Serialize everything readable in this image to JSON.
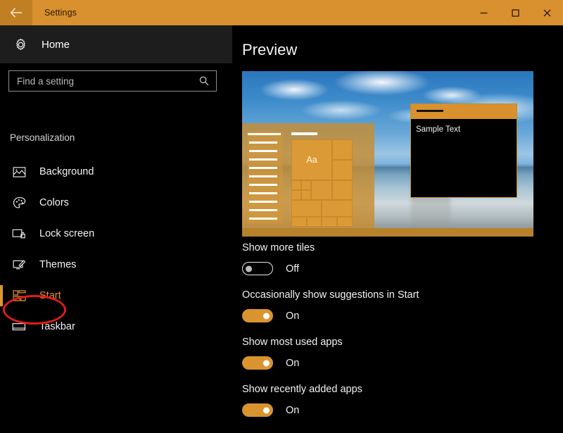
{
  "titlebar": {
    "back_label": "back-arrow",
    "title": "Settings",
    "minimize_label": "Minimize",
    "maximize_label": "Maximize",
    "close_label": "Close",
    "bg_color": "#d8912e"
  },
  "sidebar": {
    "home_label": "Home",
    "search": {
      "placeholder": "Find a setting",
      "value": ""
    },
    "section_header": "Personalization",
    "items": [
      {
        "label": "Background",
        "icon": "picture-icon",
        "selected": false
      },
      {
        "label": "Colors",
        "icon": "palette-icon",
        "selected": false
      },
      {
        "label": "Lock screen",
        "icon": "lock-screen-icon",
        "selected": false
      },
      {
        "label": "Themes",
        "icon": "themes-icon",
        "selected": false
      },
      {
        "label": "Start",
        "icon": "start-tiles-icon",
        "selected": true
      },
      {
        "label": "Taskbar",
        "icon": "taskbar-icon",
        "selected": false
      }
    ],
    "annotation": {
      "type": "red-ellipse",
      "target": "Start",
      "color": "#e01b1b"
    },
    "accent_color": "#e0972f"
  },
  "content": {
    "page_title": "Preview",
    "preview": {
      "wallpaper": "beach-rock-reflection-wallpaper",
      "start_menu_tile_text": "Aa",
      "sample_window_text": "Sample Text"
    },
    "settings": [
      {
        "label": "Show more tiles",
        "state": "Off",
        "on": false
      },
      {
        "label": "Occasionally show suggestions in Start",
        "state": "On",
        "on": true
      },
      {
        "label": "Show most used apps",
        "state": "On",
        "on": true
      },
      {
        "label": "Show recently added apps",
        "state": "On",
        "on": true
      }
    ]
  }
}
